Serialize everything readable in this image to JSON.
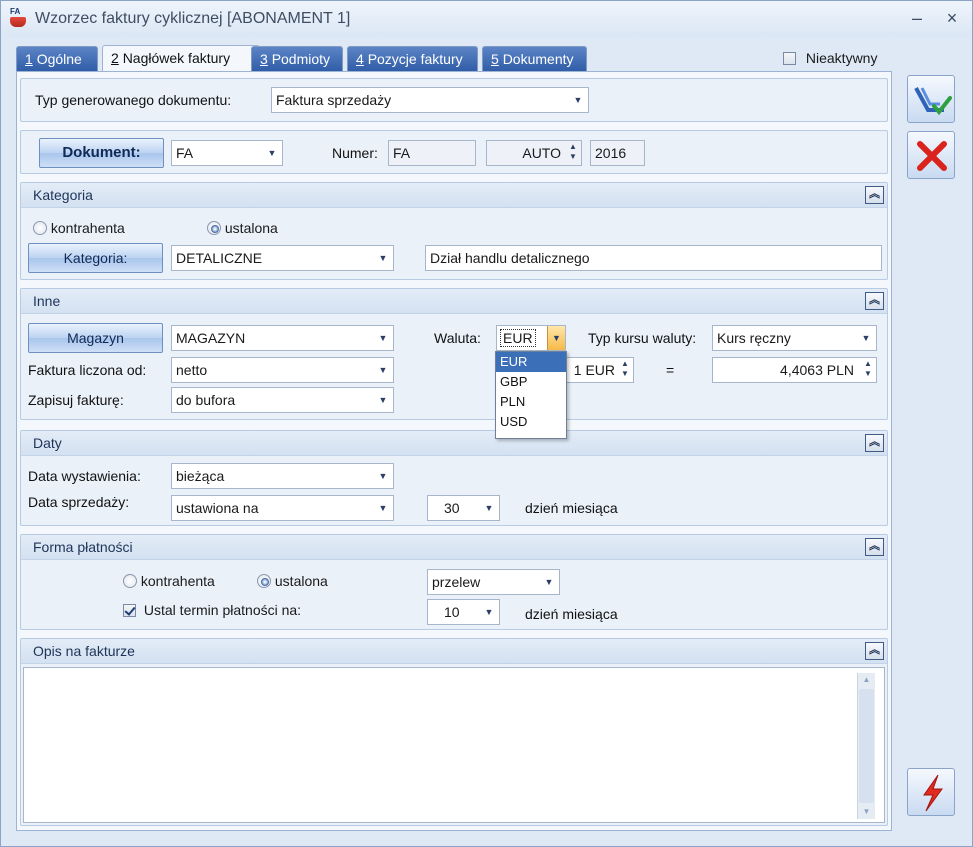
{
  "window": {
    "title": "Wzorzec faktury cyklicznej [ABONAMENT 1]",
    "app_icon_text": "FA",
    "minimize": "–",
    "close": "×"
  },
  "tabs": [
    {
      "key": "1",
      "label": "Ogólne"
    },
    {
      "key": "2",
      "label": "Nagłówek faktury"
    },
    {
      "key": "3",
      "label": "Podmioty"
    },
    {
      "key": "4",
      "label": "Pozycje faktury"
    },
    {
      "key": "5",
      "label": "Dokumenty"
    }
  ],
  "inactive_checkbox": {
    "label": "Nieaktywny",
    "checked": false
  },
  "doc_type": {
    "label": "Typ generowanego dokumentu:",
    "value": "Faktura sprzedaży"
  },
  "document": {
    "button": "Dokument:",
    "series": "FA",
    "number_label": "Numer:",
    "number_prefix": "FA",
    "number_mode": "AUTO",
    "year": "2016"
  },
  "kategoria": {
    "title": "Kategoria",
    "radio_kontrahenta": "kontrahenta",
    "radio_ustalona": "ustalona",
    "button": "Kategoria:",
    "value": "DETALICZNE",
    "description": "Dział handlu detalicznego"
  },
  "inne": {
    "title": "Inne",
    "magazyn_button": "Magazyn",
    "magazyn_value": "MAGAZYN",
    "faktura_label": "Faktura liczona od:",
    "faktura_value": "netto",
    "zapisuj_label": "Zapisuj fakturę:",
    "zapisuj_value": "do bufora",
    "waluta_label": "Waluta:",
    "waluta_value": "EUR",
    "typ_kursu_label": "Typ kursu waluty:",
    "typ_kursu_value": "Kurs ręczny",
    "rate_left": "1 EUR",
    "equals": "=",
    "rate_right": "4,4063 PLN",
    "currency_options": [
      "EUR",
      "GBP",
      "PLN",
      "USD"
    ]
  },
  "daty": {
    "title": "Daty",
    "wystawienia_label": "Data wystawienia:",
    "wystawienia_value": "bieżąca",
    "sprzedazy_label": "Data sprzedaży:",
    "sprzedazy_value": "ustawiona na",
    "day_value": "30",
    "day_suffix": "dzień miesiąca"
  },
  "platnosc": {
    "title": "Forma płatności",
    "radio_kontrahenta": "kontrahenta",
    "radio_ustalona": "ustalona",
    "method": "przelew",
    "termin_label": "Ustal termin płatności na:",
    "termin_checked": true,
    "day_value": "10",
    "day_suffix": "dzień miesiąca"
  },
  "opis": {
    "title": "Opis na fakturze",
    "value": ""
  },
  "colors": {
    "accent": "#2f5ca6",
    "selection": "#3b6fb8"
  }
}
